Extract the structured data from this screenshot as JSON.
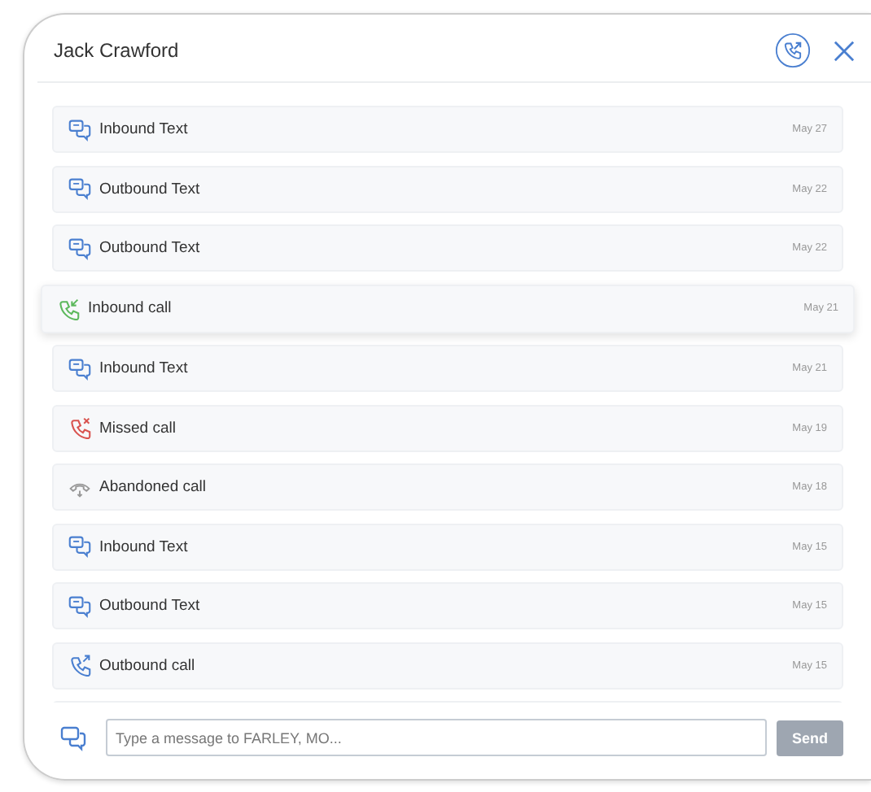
{
  "header": {
    "title": "Jack Crawford"
  },
  "items": [
    {
      "kind": "text",
      "label": "Inbound Text",
      "date": "May 27",
      "selected": false
    },
    {
      "kind": "text",
      "label": "Outbound Text",
      "date": "May 22",
      "selected": false
    },
    {
      "kind": "text",
      "label": "Outbound Text",
      "date": "May 22",
      "selected": false
    },
    {
      "kind": "call-in",
      "label": "Inbound call",
      "date": "May 21",
      "selected": true
    },
    {
      "kind": "text",
      "label": "Inbound Text",
      "date": "May 21",
      "selected": false
    },
    {
      "kind": "call-missed",
      "label": "Missed call",
      "date": "May 19",
      "selected": false
    },
    {
      "kind": "call-abandoned",
      "label": "Abandoned call",
      "date": "May 18",
      "selected": false
    },
    {
      "kind": "text",
      "label": "Inbound Text",
      "date": "May 15",
      "selected": false
    },
    {
      "kind": "text",
      "label": "Outbound Text",
      "date": "May 15",
      "selected": false
    },
    {
      "kind": "call-out",
      "label": "Outbound call",
      "date": "May 15",
      "selected": false
    }
  ],
  "composer": {
    "placeholder": "Type a message to FARLEY, MO...",
    "send": "Send"
  }
}
